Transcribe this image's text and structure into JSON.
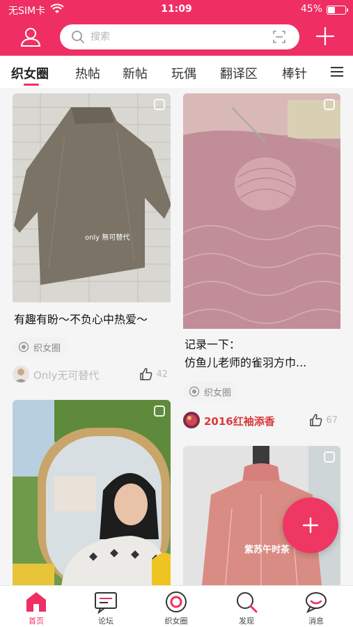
{
  "status_bar": {
    "carrier": "无SIM卡",
    "time": "11:09",
    "battery_text": "45%",
    "battery_level": 0.45,
    "wifi_icon": "wifi-icon"
  },
  "header": {
    "left_icon": "user-icon",
    "search_placeholder": "搜索",
    "scan_icon": "scan-icon",
    "right_icon": "plus-icon"
  },
  "tabs": [
    {
      "label": "织女圈",
      "active": true
    },
    {
      "label": "热帖"
    },
    {
      "label": "新帖"
    },
    {
      "label": "玩偶"
    },
    {
      "label": "翻译区"
    },
    {
      "label": "棒针"
    }
  ],
  "tabs_menu_icon": "menu-icon",
  "feed": {
    "left": [
      {
        "title": "有趣有盼～不负心中热爱～",
        "circle": "织女圈",
        "author": "Only无可替代",
        "likes": "42",
        "image_text": "only 無可替代"
      },
      {
        "title": "",
        "circle": "",
        "author": "",
        "likes": ""
      }
    ],
    "right": [
      {
        "title": "记录一下：\n仿鱼儿老师的雀羽方巾...",
        "circle": "织女圈",
        "author": "2016红袖添香",
        "likes": "67"
      },
      {
        "title": "",
        "circle": "",
        "author": "",
        "likes": "",
        "image_text": "紫苏午时茶"
      }
    ]
  },
  "fab_icon": "plus-icon",
  "bottom_nav": [
    {
      "label": "首页",
      "icon": "home-icon",
      "active": true
    },
    {
      "label": "论坛",
      "icon": "forum-icon"
    },
    {
      "label": "织女圈",
      "icon": "circle-icon"
    },
    {
      "label": "发现",
      "icon": "discover-icon"
    },
    {
      "label": "消息",
      "icon": "message-icon"
    }
  ],
  "colors": {
    "brand": "#ef2f63",
    "author_highlight": "#d93a3a"
  }
}
